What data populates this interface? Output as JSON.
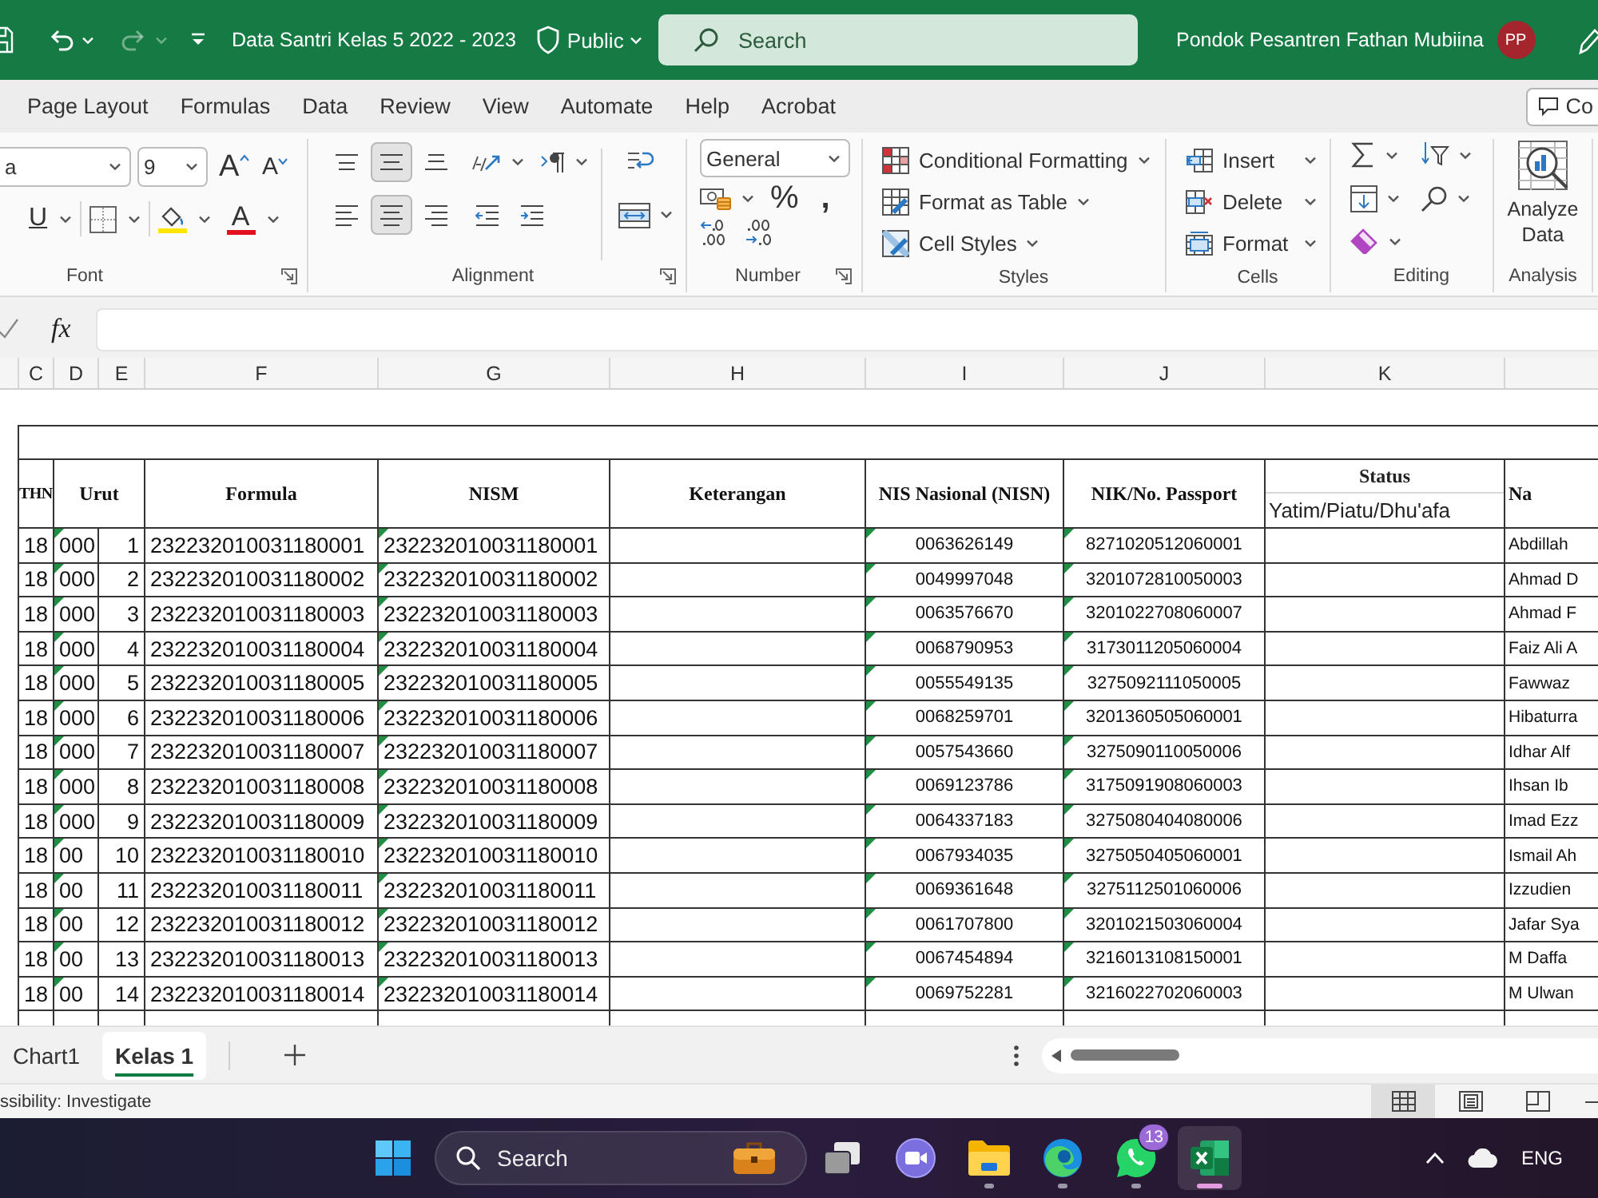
{
  "title_bar": {
    "quick_access": [
      {
        "kind": "undo",
        "disabled": false
      },
      {
        "kind": "redo",
        "disabled": true
      }
    ],
    "document_title": "Data Santri Kelas 5 2022 - 2023",
    "sensitivity": "Public",
    "search": {
      "placeholder": "Search"
    },
    "account_name": "Pondok Pesantren Fathan Mubiina",
    "avatar_initials": "PP"
  },
  "ribbon": {
    "tabs": [
      {
        "label": "Page Layout",
        "selected": false
      },
      {
        "label": "Formulas",
        "selected": false
      },
      {
        "label": "Data",
        "selected": false
      },
      {
        "label": "Review",
        "selected": false
      },
      {
        "label": "View",
        "selected": false
      },
      {
        "label": "Automate",
        "selected": false
      },
      {
        "label": "Help",
        "selected": false
      },
      {
        "label": "Acrobat",
        "selected": false
      }
    ],
    "comments_button": "Co",
    "font": {
      "font_name": "a",
      "font_size": "9",
      "grow_font": "A",
      "shrink_font": "A",
      "underline": "U",
      "font_color": "A",
      "label": "Font"
    },
    "alignment": {
      "vertical": [
        {
          "kind": "top",
          "selected": false
        },
        {
          "kind": "middle",
          "selected": true
        },
        {
          "kind": "bottom",
          "selected": false
        }
      ],
      "horizontal": [
        {
          "kind": "left",
          "selected": false
        },
        {
          "kind": "center",
          "selected": true
        },
        {
          "kind": "right",
          "selected": false
        }
      ],
      "label": "Alignment"
    },
    "number": {
      "format": "General",
      "percent": "%",
      "comma": ",",
      "label": "Number"
    },
    "styles": {
      "buttons": [
        "Conditional Formatting",
        "Format as Table",
        "Cell Styles"
      ],
      "label": "Styles"
    },
    "cells": {
      "buttons": [
        "Insert",
        "Delete",
        "Format"
      ],
      "label": "Cells"
    },
    "editing": {
      "label": "Editing"
    },
    "analysis": {
      "button": "Analyze Data",
      "label": "Analysis"
    }
  },
  "formula_bar": {
    "function_label": "fx"
  },
  "sheet": {
    "columns": [
      {
        "letter": "C",
        "error_flags": false
      },
      {
        "letter": "D",
        "error_flags": true
      },
      {
        "letter": "E",
        "error_flags": false
      },
      {
        "letter": "F",
        "error_flags": false
      },
      {
        "letter": "G",
        "error_flags": true
      },
      {
        "letter": "H",
        "error_flags": false
      },
      {
        "letter": "I",
        "error_flags": true
      },
      {
        "letter": "J",
        "error_flags": true
      },
      {
        "letter": "K",
        "error_flags": false
      }
    ],
    "header": {
      "year": "THN",
      "order": "Urut",
      "formula": "Formula",
      "nism": "NISM",
      "note": "Keterangan",
      "nisn": "NIS Nasional (NISN)",
      "nik": "NIK/No. Passport",
      "status": "Status",
      "status_detail": "Yatim/Piatu/Dhu'afa",
      "name": "Na"
    },
    "rows": [
      {
        "year": "18",
        "code": "000",
        "number": "1",
        "formula": "232232010031180001",
        "nism": "232232010031180001",
        "nisn": "0063626149",
        "nik": "8271020512060001",
        "name": "Abdillah"
      },
      {
        "year": "18",
        "code": "000",
        "number": "2",
        "formula": "232232010031180002",
        "nism": "232232010031180002",
        "nisn": "0049997048",
        "nik": "3201072810050003",
        "name": "Ahmad D"
      },
      {
        "year": "18",
        "code": "000",
        "number": "3",
        "formula": "232232010031180003",
        "nism": "232232010031180003",
        "nisn": "0063576670",
        "nik": "3201022708060007",
        "name": "Ahmad F"
      },
      {
        "year": "18",
        "code": "000",
        "number": "4",
        "formula": "232232010031180004",
        "nism": "232232010031180004",
        "nisn": "0068790953",
        "nik": "3173011205060004",
        "name": "Faiz Ali A"
      },
      {
        "year": "18",
        "code": "000",
        "number": "5",
        "formula": "232232010031180005",
        "nism": "232232010031180005",
        "nisn": "0055549135",
        "nik": "3275092111050005",
        "name": "Fawwaz"
      },
      {
        "year": "18",
        "code": "000",
        "number": "6",
        "formula": "232232010031180006",
        "nism": "232232010031180006",
        "nisn": "0068259701",
        "nik": "3201360505060001",
        "name": "Hibaturra"
      },
      {
        "year": "18",
        "code": "000",
        "number": "7",
        "formula": "232232010031180007",
        "nism": "232232010031180007",
        "nisn": "0057543660",
        "nik": "3275090110050006",
        "name": "Idhar Alf"
      },
      {
        "year": "18",
        "code": "000",
        "number": "8",
        "formula": "232232010031180008",
        "nism": "232232010031180008",
        "nisn": "0069123786",
        "nik": "3175091908060003",
        "name": "Ihsan Ib"
      },
      {
        "year": "18",
        "code": "000",
        "number": "9",
        "formula": "232232010031180009",
        "nism": "232232010031180009",
        "nisn": "0064337183",
        "nik": "3275080404080006",
        "name": "Imad Ezz"
      },
      {
        "year": "18",
        "code": "00",
        "number": "10",
        "formula": "232232010031180010",
        "nism": "232232010031180010",
        "nisn": "0067934035",
        "nik": "3275050405060001",
        "name": "Ismail Ah"
      },
      {
        "year": "18",
        "code": "00",
        "number": "11",
        "formula": "232232010031180011",
        "nism": "232232010031180011",
        "nisn": "0069361648",
        "nik": "3275112501060006",
        "name": "Izzudien"
      },
      {
        "year": "18",
        "code": "00",
        "number": "12",
        "formula": "232232010031180012",
        "nism": "232232010031180012",
        "nisn": "0061707800",
        "nik": "3201021503060004",
        "name": "Jafar Sya"
      },
      {
        "year": "18",
        "code": "00",
        "number": "13",
        "formula": "232232010031180013",
        "nism": "232232010031180013",
        "nisn": "0067454894",
        "nik": "3216013108150001",
        "name": "M Daffa"
      },
      {
        "year": "18",
        "code": "00",
        "number": "14",
        "formula": "232232010031180014",
        "nism": "232232010031180014",
        "nisn": "0069752281",
        "nik": "3216022702060003",
        "name": "M Ulwan"
      }
    ]
  },
  "sheet_tabs": [
    {
      "label": "Chart1",
      "selected": false
    },
    {
      "label": "Kelas 1",
      "selected": true
    }
  ],
  "status_bar": {
    "text": "ssibility: Investigate",
    "views": [
      {
        "kind": "normal",
        "selected": true
      },
      {
        "kind": "page_layout",
        "selected": false
      },
      {
        "kind": "page_break",
        "selected": false
      }
    ]
  },
  "taskbar": {
    "search": {
      "placeholder": "Search"
    },
    "apps": [
      {
        "kind": "task_view",
        "running": false,
        "selected": false
      },
      {
        "kind": "video_chat",
        "running": false,
        "selected": false
      },
      {
        "kind": "folder",
        "running": true,
        "selected": false
      },
      {
        "kind": "browser",
        "running": true,
        "selected": false
      },
      {
        "kind": "chat",
        "running": true,
        "selected": false,
        "badge": "13"
      },
      {
        "kind": "spreadsheet",
        "running": true,
        "selected": true
      }
    ],
    "language": "ENG"
  }
}
